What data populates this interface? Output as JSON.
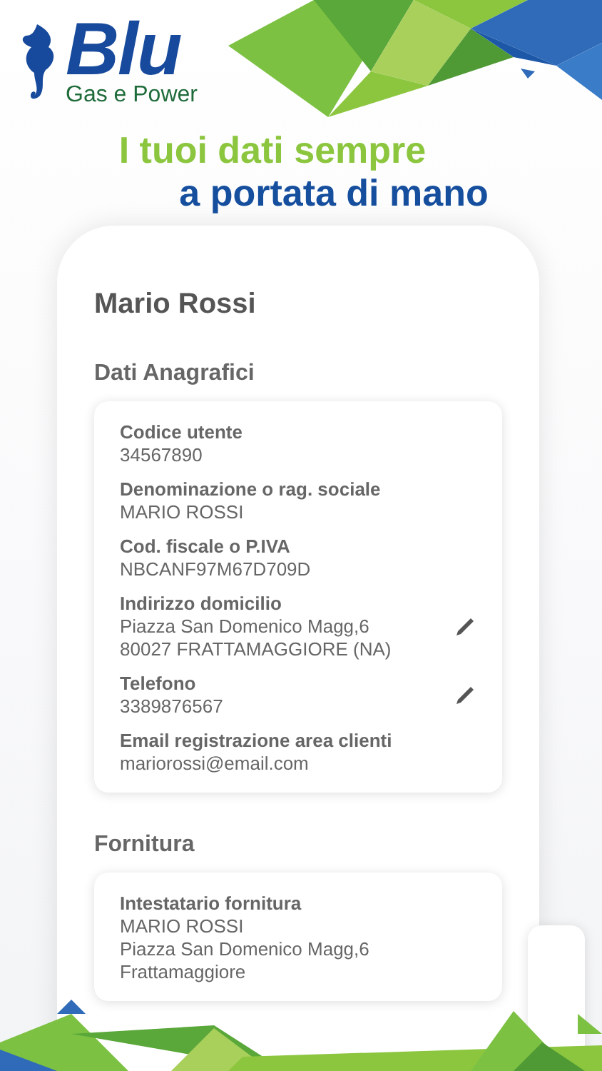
{
  "brand": {
    "name": "Blu",
    "tagline": "Gas e Power"
  },
  "headline": {
    "line_1": "I tuoi dati sempre",
    "line_2": "a portata di mano"
  },
  "profile": {
    "name": "Mario Rossi"
  },
  "sections": [
    {
      "title": "Dati Anagrafici",
      "fields": [
        {
          "label": "Codice utente",
          "lines": [
            "34567890"
          ],
          "editable": false
        },
        {
          "label": "Denominazione o rag. sociale",
          "lines": [
            "MARIO ROSSI"
          ],
          "editable": false
        },
        {
          "label": "Cod. fiscale o P.IVA",
          "lines": [
            "NBCANF97M67D709D"
          ],
          "editable": false
        },
        {
          "label": "Indirizzo domicilio",
          "lines": [
            "Piazza San Domenico Magg,6",
            "80027 FRATTAMAGGIORE (NA)"
          ],
          "editable": true
        },
        {
          "label": "Telefono",
          "lines": [
            "3389876567"
          ],
          "editable": true
        },
        {
          "label": "Email registrazione area clienti",
          "lines": [
            "mariorossi@email.com"
          ],
          "editable": false
        }
      ]
    },
    {
      "title": "Fornitura",
      "fields": [
        {
          "label": "Intestatario fornitura",
          "lines": [
            "MARIO ROSSI",
            "Piazza San Domenico Magg,6",
            "Frattamaggiore"
          ],
          "editable": false
        }
      ]
    }
  ]
}
